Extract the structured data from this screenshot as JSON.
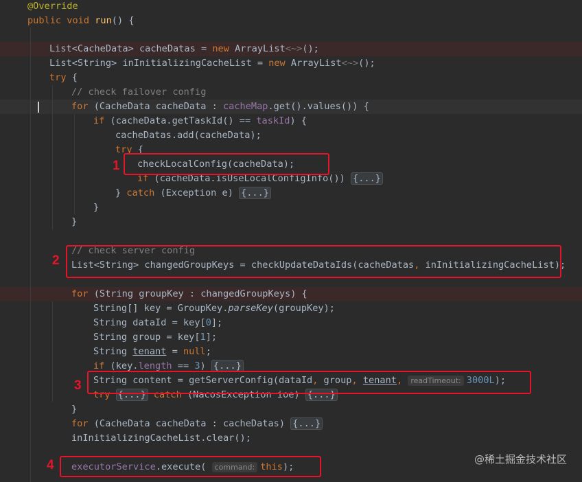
{
  "code": {
    "annotation": "@Override",
    "run_sig": {
      "kw1": "public",
      "kw2": "void",
      "name": "run",
      "rest": "() {"
    },
    "cache_datas_line": {
      "a": "List<CacheData> cacheDatas = ",
      "kw": "new",
      "b": " ArrayList",
      "diamond": "<~>",
      "c": "();"
    },
    "init_list_line": {
      "a": "List<String> inInitializingCacheList = ",
      "kw": "new",
      "b": " ArrayList",
      "diamond": "<~>",
      "c": "();"
    },
    "try1": {
      "kw": "try",
      "rest": " {"
    },
    "comment_failover": "// check failover config",
    "for_cachemap": {
      "kw": "for",
      "a": " (CacheData cacheData : ",
      "field": "cacheMap",
      "b": ".get().values()) {"
    },
    "if_taskid": {
      "kw": "if",
      "a": " (cacheData.getTaskId() == ",
      "field": "taskId",
      "b": ") {"
    },
    "add_line": "cacheDatas.add(cacheData);",
    "try2": {
      "kw": "try",
      "rest": " {"
    },
    "check_local": "checkLocalConfig(cacheData);",
    "if_local": {
      "kw": "if",
      "a": " (cacheData.isUseLocalConfigInfo()) ",
      "fold": "{...}"
    },
    "catch1": {
      "a": "} ",
      "kw": "catch",
      "b": " (Exception e) ",
      "fold": "{...}"
    },
    "close_brace": "}",
    "comment_server": "// check server config",
    "changed_keys": {
      "a": "List<String> changedGroupKeys = checkUpdateDataIds(cacheDatas",
      "comma": ",",
      "b": " inInitializingCacheList);"
    },
    "for_groupkey": {
      "kw": "for",
      "rest": " (String groupKey : changedGroupKeys) {"
    },
    "key_line": {
      "a": "String[] key = GroupKey.",
      "method": "parseKey",
      "b": "(groupKey);"
    },
    "dataid_line": {
      "a": "String dataId = key[",
      "num": "0",
      "b": "];"
    },
    "group_line": {
      "a": "String group = key[",
      "num": "1",
      "b": "];"
    },
    "tenant_line": {
      "a": "String ",
      "var": "tenant",
      "b": " = ",
      "kw": "null",
      "c": ";"
    },
    "if_length": {
      "kw": "if",
      "a": " (key.",
      "field": "length",
      "b": " == ",
      "num": "3",
      "c": ") ",
      "fold": "{...}"
    },
    "content_line": {
      "a": "String content = getServerConfig(dataId",
      "c1": ",",
      "b": " group",
      "c2": ",",
      "sp": " ",
      "var": "tenant",
      "c3": ",",
      "hint": "readTimeout:",
      "num": "3000L",
      "c": ");"
    },
    "try_catch_line": {
      "kw1": "try",
      "fold1": "{...}",
      "kw2": "catch",
      "mid": " (NacosException ioe) ",
      "fold2": "{...}"
    },
    "for_cachedatas": {
      "kw": "for",
      "a": " (CacheData cacheData : cacheDatas) ",
      "fold": "{...}"
    },
    "clear_line": "inInitializingCacheList.clear();",
    "execute_line": {
      "field": "executorService",
      "a": ".execute(",
      "hint": "command:",
      "kw": "this",
      "b": ");"
    }
  },
  "markers": {
    "m1": "1",
    "m2": "2",
    "m3": "3",
    "m4": "4"
  },
  "watermark": "@稀土掘金技术社区",
  "colors": {
    "background": "#2b2b2b",
    "text": "#a9b7c6",
    "keyword": "#cc7832",
    "annotation": "#bbb529",
    "method": "#ffc66d",
    "field": "#9876aa",
    "number": "#6897bb",
    "comment": "#808080",
    "highlight_box": "#e3152b"
  }
}
